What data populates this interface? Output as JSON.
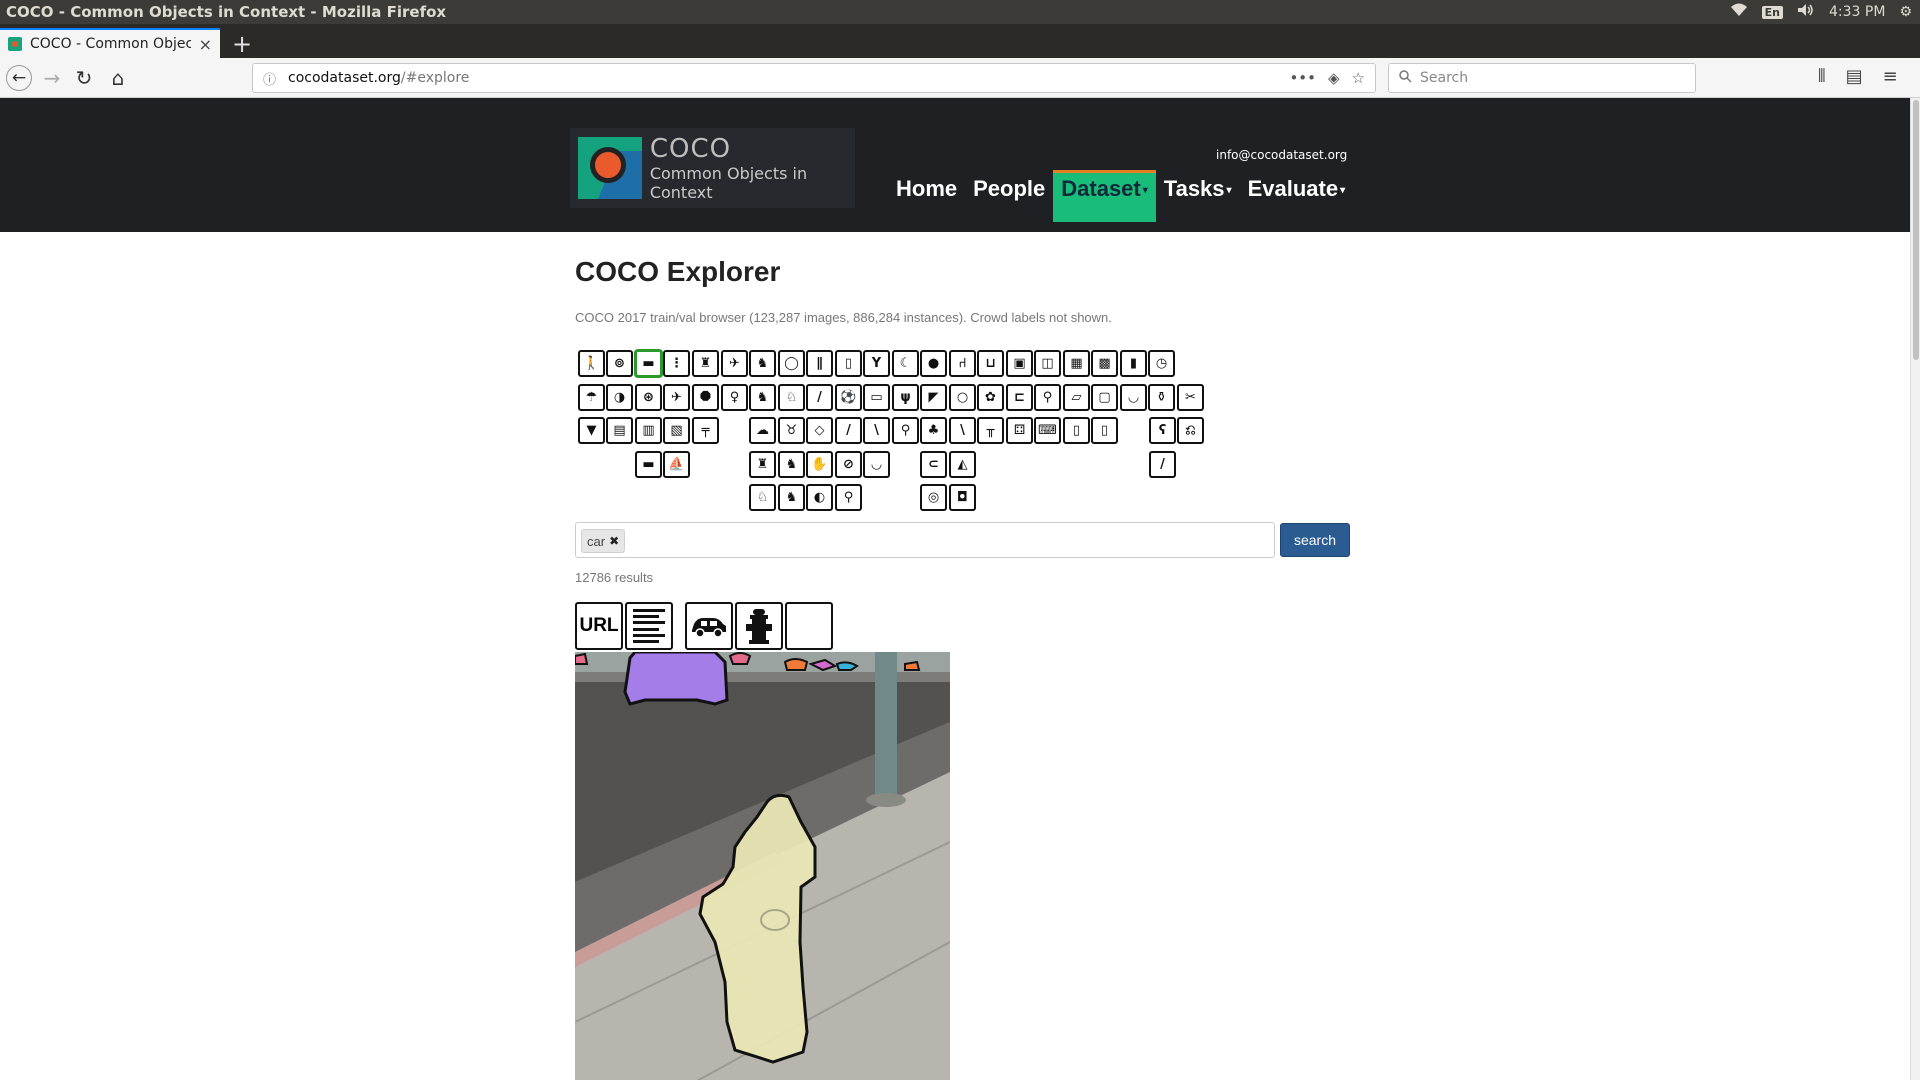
{
  "os": {
    "window_title": "COCO - Common Objects in Context - Mozilla Firefox",
    "lang": "En",
    "time": "4:33 PM"
  },
  "browser": {
    "tab_title": "COCO - Common Object",
    "url_host": "cocodataset.org",
    "url_path": "/#explore",
    "search_placeholder": "Search"
  },
  "site": {
    "logo_title": "COCO",
    "logo_subtitle": "Common Objects in Context",
    "email": "info@cocodataset.org",
    "nav": [
      "Home",
      "People",
      "Dataset",
      "Tasks",
      "Evaluate"
    ],
    "active_nav": "Dataset"
  },
  "explorer": {
    "title": "COCO Explorer",
    "subtitle": "COCO 2017 train/val browser (123,287 images, 886,284 instances). Crowd labels not shown.",
    "selected_category": "car",
    "search_tag": "car",
    "search_button": "search",
    "result_count": "12786 results",
    "toolbar_url": "URL",
    "category_icons": [
      [
        "person",
        "bicycle",
        "car",
        "traffic-light",
        "fire-hydrant",
        "bird",
        "cat",
        "frisbee",
        "skis",
        "bottle",
        "wine-glass",
        "banana",
        "apple",
        "chair",
        "couch",
        "tv",
        "laptop",
        "microwave",
        "oven",
        "book",
        "clock"
      ],
      [
        "umbrella",
        "handbag",
        "motorcycle",
        "airplane",
        "stop-sign",
        "parking-meter",
        "dog",
        "horse",
        "snowboard",
        "sports-ball",
        "cup",
        "fork",
        "sandwich",
        "orange",
        "potted-plant",
        "bed",
        "mouse",
        "remote",
        "toaster",
        "sink",
        "vase",
        "scissors"
      ],
      [
        "tie",
        "suitcase",
        "bus",
        "train",
        "bench",
        "sheep",
        "cow",
        "kite",
        "baseball-bat",
        "knife",
        "spoon",
        "broccoli",
        "carrot",
        "dining-table",
        "toilet",
        "keyboard",
        "cell-phone",
        "refrigerator",
        "teddy-bear",
        "hair-drier"
      ],
      [
        "truck",
        "boat",
        "elephant",
        "bear",
        "baseball-glove",
        "skateboard",
        "bowl",
        "hot-dog",
        "pizza",
        "toothbrush"
      ],
      [
        "zebra",
        "giraffe",
        "surfboard",
        "tennis-racket",
        "donut",
        "cake"
      ]
    ],
    "colors": {
      "header_bg": "#1e2024",
      "active_nav": "#1abc7a",
      "search_btn": "#2a5c92",
      "selected_border": "#2b9a2b",
      "car_mask": "#a57de8",
      "hydrant_fill": "#e8e6b4"
    }
  }
}
